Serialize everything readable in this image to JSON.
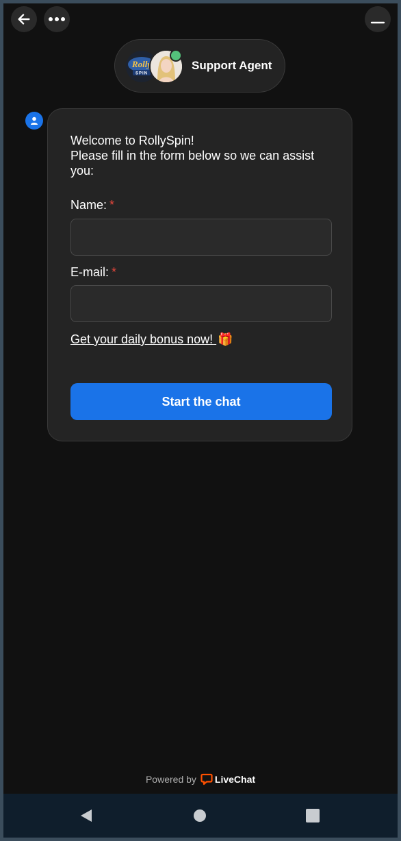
{
  "header": {
    "back_icon": "arrow-left-icon",
    "menu_icon": "more-horizontal-icon",
    "minimize_icon": "minimize-icon"
  },
  "agent": {
    "logo_text": "Rolly Spin",
    "name": "Support Agent",
    "status_color": "#54c27b"
  },
  "form": {
    "welcome_line1": "Welcome to RollySpin!",
    "welcome_line2": "Please fill in the form below so we can assist you:",
    "name_label": "Name:",
    "email_label": "E-mail:",
    "required_mark": "*",
    "name_value": "",
    "email_value": "",
    "bonus_link": "Get your daily bonus now!",
    "bonus_emoji": "🎁",
    "submit_label": "Start the chat"
  },
  "footer": {
    "powered_by": "Powered by",
    "brand": "LiveChat"
  },
  "colors": {
    "accent": "#1a73e8",
    "required": "#e8473c",
    "livechat": "#ff5100"
  }
}
